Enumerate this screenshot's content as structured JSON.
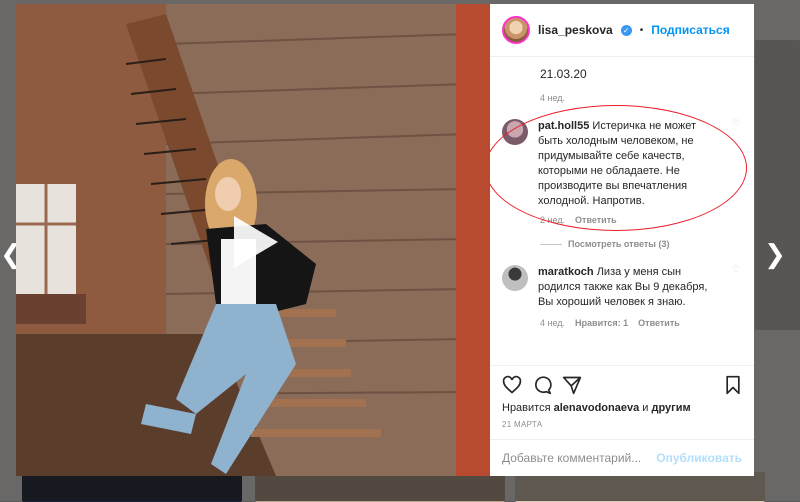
{
  "header": {
    "username": "lisa_peskova",
    "follow_label": "Подписаться",
    "separator": "•"
  },
  "comments": {
    "first": {
      "text": "21.03.20",
      "time": "4 нед."
    },
    "highlighted": {
      "username": "pat.holl55",
      "text": "Истеричка не может быть холодным человеком, не придумывайте себе качеств, которыми не обладаете. Не производите вы впечатления холодной. Напротив.",
      "time": "2 нед.",
      "reply_label": "Ответить",
      "view_replies": "Посмотреть ответы (3)"
    },
    "second": {
      "username": "maratkoch",
      "text": "Лиза у меня сын родился также как Вы 9 декабря, Вы хороший человек я знаю.",
      "time": "4 нед.",
      "likes_label": "Нравится: 1",
      "reply_label": "Ответить"
    }
  },
  "likes": {
    "prefix": "Нравится",
    "user": "alenavodonaeva",
    "mid": "и",
    "others": "другим"
  },
  "post_date": "21 МАРТА",
  "comment_box": {
    "placeholder": "Добавьте комментарий...",
    "publish_label": "Опубликовать"
  },
  "icons": {
    "prev": "chevron-left-icon",
    "next": "chevron-right-icon",
    "play": "play-icon",
    "like": "heart-icon",
    "comment": "comment-icon",
    "share": "send-icon",
    "save": "bookmark-icon",
    "verified": "verified-badge-icon"
  },
  "colors": {
    "accent": "#0095f6",
    "highlight_circle": "#e8202a",
    "muted": "#8e8e8e"
  }
}
